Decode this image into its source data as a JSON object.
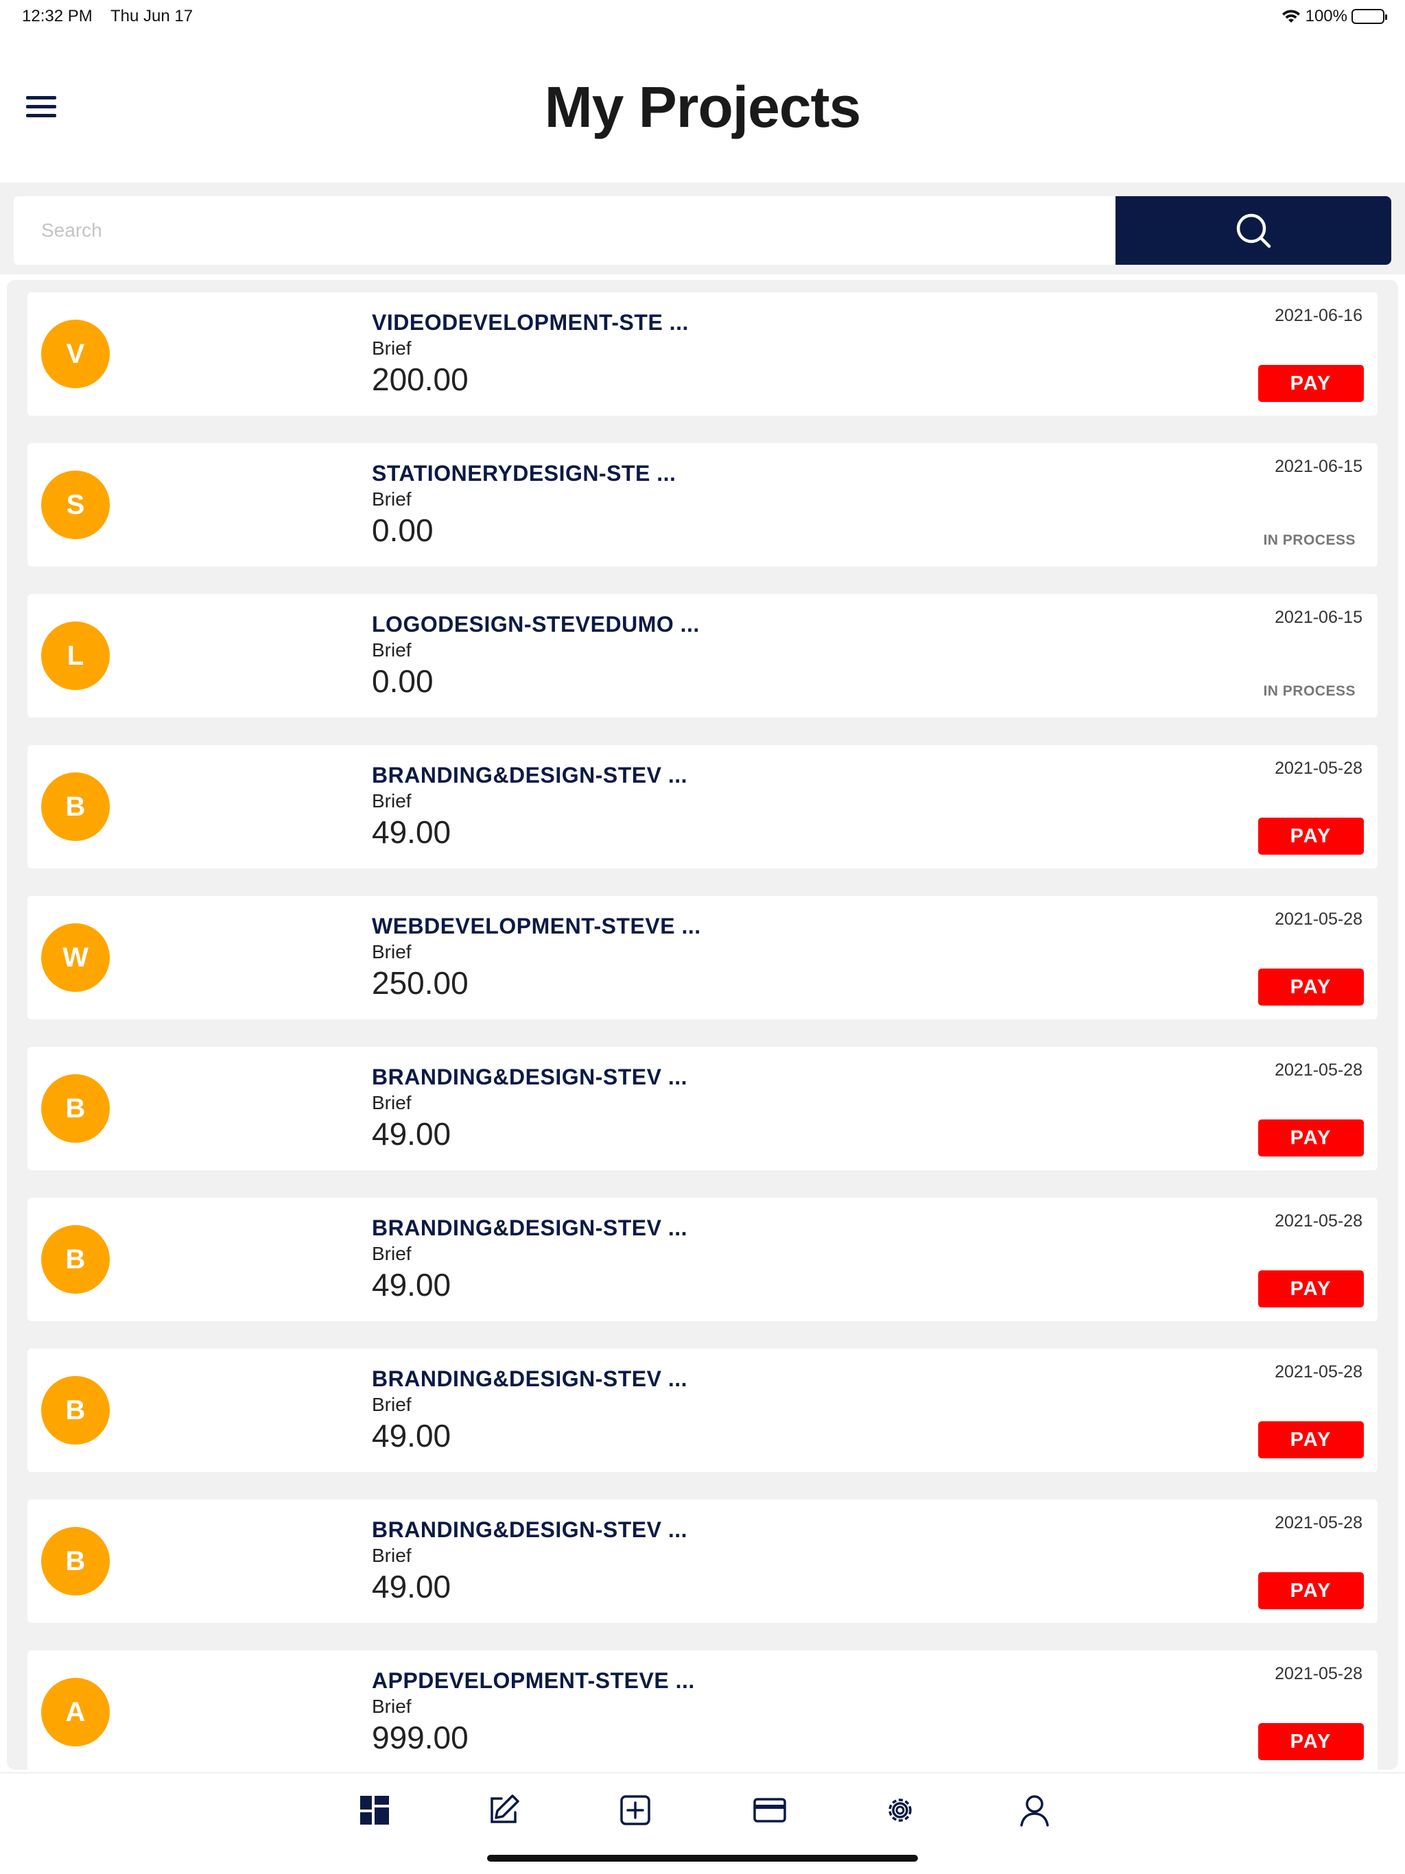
{
  "status_bar": {
    "time": "12:32 PM",
    "date": "Thu Jun 17",
    "battery": "100%"
  },
  "header": {
    "title": "My Projects"
  },
  "search": {
    "placeholder": "Search"
  },
  "projects": [
    {
      "initial": "V",
      "title": "VIDEODEVELOPMENT-STE ...",
      "subtitle": "Brief",
      "amount": "200.00",
      "date": "2021-06-16",
      "action": "PAY"
    },
    {
      "initial": "S",
      "title": "STATIONERYDESIGN-STE ...",
      "subtitle": "Brief",
      "amount": "0.00",
      "date": "2021-06-15",
      "status": "IN PROCESS"
    },
    {
      "initial": "L",
      "title": "LOGODESIGN-STEVEDUMO ...",
      "subtitle": "Brief",
      "amount": "0.00",
      "date": "2021-06-15",
      "status": "IN PROCESS"
    },
    {
      "initial": "B",
      "title": "BRANDING&DESIGN-STEV ...",
      "subtitle": "Brief",
      "amount": "49.00",
      "date": "2021-05-28",
      "action": "PAY"
    },
    {
      "initial": "W",
      "title": "WEBDEVELOPMENT-STEVE ...",
      "subtitle": "Brief",
      "amount": "250.00",
      "date": "2021-05-28",
      "action": "PAY"
    },
    {
      "initial": "B",
      "title": "BRANDING&DESIGN-STEV ...",
      "subtitle": "Brief",
      "amount": "49.00",
      "date": "2021-05-28",
      "action": "PAY"
    },
    {
      "initial": "B",
      "title": "BRANDING&DESIGN-STEV ...",
      "subtitle": "Brief",
      "amount": "49.00",
      "date": "2021-05-28",
      "action": "PAY"
    },
    {
      "initial": "B",
      "title": "BRANDING&DESIGN-STEV ...",
      "subtitle": "Brief",
      "amount": "49.00",
      "date": "2021-05-28",
      "action": "PAY"
    },
    {
      "initial": "B",
      "title": "BRANDING&DESIGN-STEV ...",
      "subtitle": "Brief",
      "amount": "49.00",
      "date": "2021-05-28",
      "action": "PAY"
    },
    {
      "initial": "A",
      "title": "APPDEVELOPMENT-STEVE ...",
      "subtitle": "Brief",
      "amount": "999.00",
      "date": "2021-05-28",
      "action": "PAY"
    }
  ],
  "tab_bar": [
    {
      "icon": "dashboard-icon"
    },
    {
      "icon": "edit-icon"
    },
    {
      "icon": "add-icon"
    },
    {
      "icon": "credit-card-icon"
    },
    {
      "icon": "settings-icon"
    },
    {
      "icon": "profile-icon"
    }
  ],
  "colors": {
    "navy": "#0b1a45",
    "avatar": "#ffa500",
    "pay": "#ff0000",
    "background": "#f1f1f1"
  }
}
